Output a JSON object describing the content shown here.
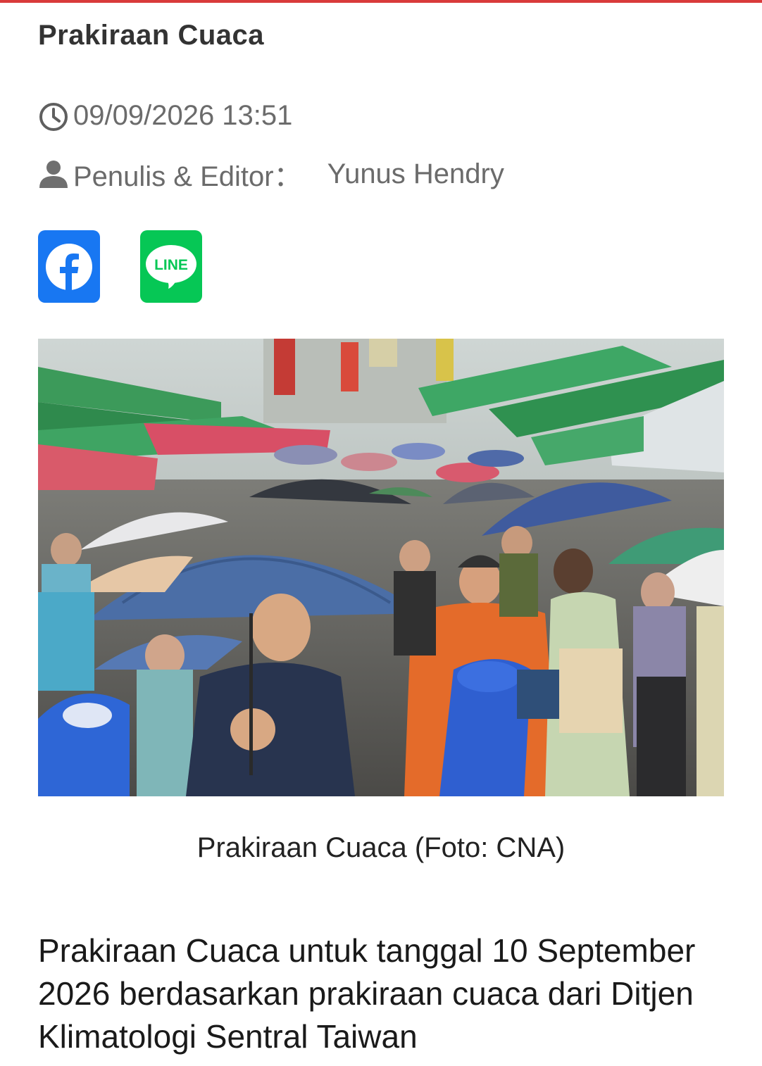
{
  "article": {
    "title": "Prakiraan Cuaca",
    "datetime": "09/09/2026 13:51",
    "author_label": "Penulis & Editor：",
    "author_name": "Yunus Hendry",
    "caption": "Prakiraan Cuaca (Foto: CNA)",
    "lead_paragraph": "Prakiraan Cuaca untuk tanggal 10 September 2026 berdasarkan prakiraan cuaca dari Ditjen Klimatologi Sentral Taiwan"
  },
  "share": {
    "facebook_icon": "facebook-icon",
    "line_icon": "line-icon",
    "line_text": "LINE"
  },
  "colors": {
    "accent_bar": "#d93a3a",
    "facebook": "#1877f2",
    "line": "#06c755",
    "meta_text": "#6b6b6b"
  }
}
